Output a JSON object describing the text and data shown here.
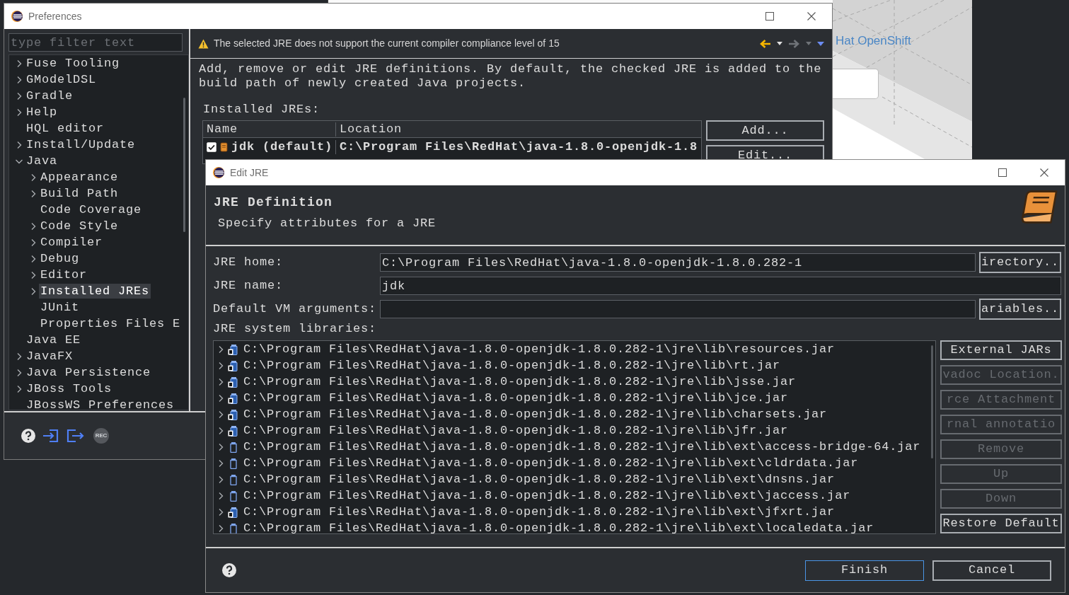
{
  "background_page": {
    "link": "Hat OpenShift"
  },
  "preferences": {
    "title": "Preferences",
    "filter": {
      "placeholder": "type filter text"
    },
    "tree": [
      {
        "label": "Fuse Tooling",
        "kind": "branch",
        "expanded": false,
        "selected": false
      },
      {
        "label": "GModelDSL",
        "kind": "branch",
        "expanded": false,
        "selected": false
      },
      {
        "label": "Gradle",
        "kind": "branch",
        "expanded": false,
        "selected": false
      },
      {
        "label": "Help",
        "kind": "branch",
        "expanded": false,
        "selected": false
      },
      {
        "label": "HQL editor",
        "kind": "leaf",
        "selected": false
      },
      {
        "label": "Install/Update",
        "kind": "branch",
        "expanded": false,
        "selected": false
      },
      {
        "label": "Java",
        "kind": "branch",
        "expanded": true,
        "selected": false,
        "children": [
          {
            "label": "Appearance",
            "kind": "branch",
            "expanded": false,
            "selected": false
          },
          {
            "label": "Build Path",
            "kind": "branch",
            "expanded": false,
            "selected": false
          },
          {
            "label": "Code Coverage",
            "kind": "leaf",
            "selected": false
          },
          {
            "label": "Code Style",
            "kind": "branch",
            "expanded": false,
            "selected": false
          },
          {
            "label": "Compiler",
            "kind": "branch",
            "expanded": false,
            "selected": false
          },
          {
            "label": "Debug",
            "kind": "branch",
            "expanded": false,
            "selected": false
          },
          {
            "label": "Editor",
            "kind": "branch",
            "expanded": false,
            "selected": false
          },
          {
            "label": "Installed JREs",
            "kind": "branch",
            "expanded": false,
            "selected": true
          },
          {
            "label": "JUnit",
            "kind": "leaf",
            "selected": false
          },
          {
            "label": "Properties Files E",
            "kind": "leaf",
            "selected": false
          }
        ]
      },
      {
        "label": "Java EE",
        "kind": "leaf",
        "selected": false
      },
      {
        "label": "JavaFX",
        "kind": "branch",
        "expanded": false,
        "selected": false
      },
      {
        "label": "Java Persistence",
        "kind": "branch",
        "expanded": false,
        "selected": false
      },
      {
        "label": "JBoss Tools",
        "kind": "branch",
        "expanded": false,
        "selected": false
      },
      {
        "label": "JBossWS Preferences",
        "kind": "leaf",
        "selected": false
      }
    ],
    "message": "The selected JRE does not support the current compiler compliance level of 15",
    "description": "Add, remove or edit JRE definitions. By default, the checked JRE is added to the build path of newly created Java projects.",
    "installed_jres": {
      "label": "Installed JREs:",
      "columns": [
        "Name",
        "Location"
      ],
      "rows": [
        {
          "checked": true,
          "name": "jdk (default)",
          "location": "C:\\Program Files\\RedHat\\java-1.8.0-openjdk-1.8"
        }
      ]
    },
    "buttons": [
      "Add...",
      "Edit..."
    ],
    "record_button": "REC"
  },
  "edit_jre": {
    "title": "Edit JRE",
    "heading": "JRE Definition",
    "subheading": "Specify attributes for a JRE",
    "fields": [
      {
        "label": "JRE home:",
        "value": "C:\\Program Files\\RedHat\\java-1.8.0-openjdk-1.8.0.282-1",
        "button": "irectory.."
      },
      {
        "label": "JRE name:",
        "value": "jdk"
      },
      {
        "label": "Default VM arguments:",
        "button": "ariables.."
      }
    ],
    "libraries_label": "JRE system libraries:",
    "libraries": [
      {
        "path": "C:\\Program Files\\RedHat\\java-1.8.0-openjdk-1.8.0.282-1\\jre\\lib\\resources.jar",
        "kind": "attached"
      },
      {
        "path": "C:\\Program Files\\RedHat\\java-1.8.0-openjdk-1.8.0.282-1\\jre\\lib\\rt.jar",
        "kind": "attached"
      },
      {
        "path": "C:\\Program Files\\RedHat\\java-1.8.0-openjdk-1.8.0.282-1\\jre\\lib\\jsse.jar",
        "kind": "attached"
      },
      {
        "path": "C:\\Program Files\\RedHat\\java-1.8.0-openjdk-1.8.0.282-1\\jre\\lib\\jce.jar",
        "kind": "attached"
      },
      {
        "path": "C:\\Program Files\\RedHat\\java-1.8.0-openjdk-1.8.0.282-1\\jre\\lib\\charsets.jar",
        "kind": "attached"
      },
      {
        "path": "C:\\Program Files\\RedHat\\java-1.8.0-openjdk-1.8.0.282-1\\jre\\lib\\jfr.jar",
        "kind": "attached"
      },
      {
        "path": "C:\\Program Files\\RedHat\\java-1.8.0-openjdk-1.8.0.282-1\\jre\\lib\\ext\\access-bridge-64.jar",
        "kind": "plain"
      },
      {
        "path": "C:\\Program Files\\RedHat\\java-1.8.0-openjdk-1.8.0.282-1\\jre\\lib\\ext\\cldrdata.jar",
        "kind": "plain"
      },
      {
        "path": "C:\\Program Files\\RedHat\\java-1.8.0-openjdk-1.8.0.282-1\\jre\\lib\\ext\\dnsns.jar",
        "kind": "plain"
      },
      {
        "path": "C:\\Program Files\\RedHat\\java-1.8.0-openjdk-1.8.0.282-1\\jre\\lib\\ext\\jaccess.jar",
        "kind": "plain"
      },
      {
        "path": "C:\\Program Files\\RedHat\\java-1.8.0-openjdk-1.8.0.282-1\\jre\\lib\\ext\\jfxrt.jar",
        "kind": "attached"
      },
      {
        "path": "C:\\Program Files\\RedHat\\java-1.8.0-openjdk-1.8.0.282-1\\jre\\lib\\ext\\localedata.jar",
        "kind": "plain"
      }
    ],
    "side_buttons": [
      {
        "label": "External JARs",
        "disabled": false
      },
      {
        "label": "vadoc Location.",
        "disabled": true
      },
      {
        "label": "rce Attachment",
        "disabled": true
      },
      {
        "label": "rnal annotatio",
        "disabled": true
      },
      {
        "label": "Remove",
        "disabled": true
      },
      {
        "label": "Up",
        "disabled": true
      },
      {
        "label": "Down",
        "disabled": true
      },
      {
        "label": "Restore Default",
        "disabled": false
      }
    ],
    "buttons": [
      {
        "label": "Finish",
        "default": true
      },
      {
        "label": "Cancel",
        "default": false
      }
    ]
  }
}
